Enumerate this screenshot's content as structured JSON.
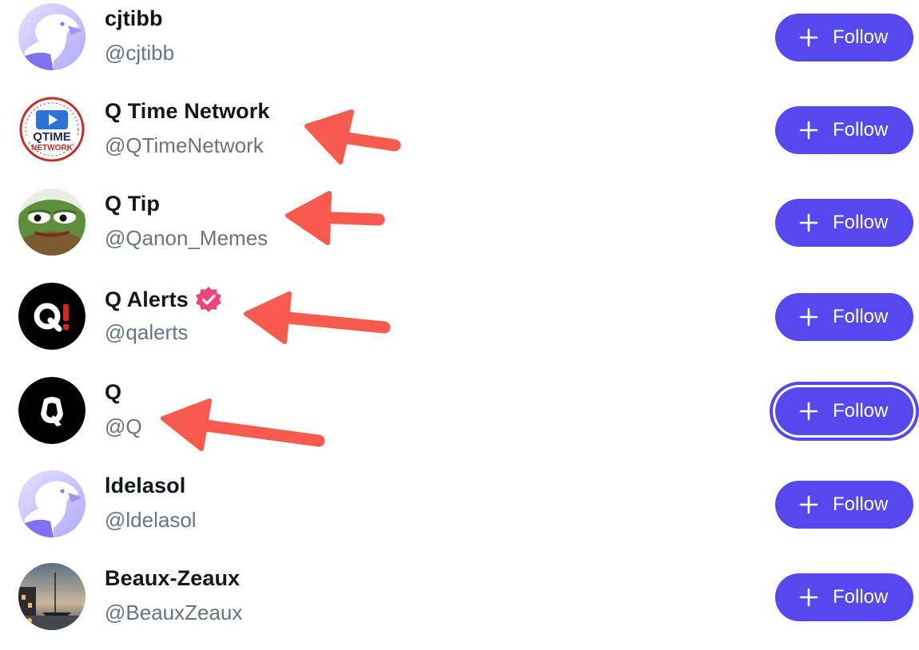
{
  "follow_label": "Follow",
  "colors": {
    "accent": "#5448ee",
    "annotation_arrow": "#f75b4e",
    "verified_badge": "#f0437c"
  },
  "users": [
    {
      "display_name": "cjtibb",
      "handle": "@cjtibb",
      "avatar": "eagle-icon",
      "verified": false,
      "arrow": false
    },
    {
      "display_name": "Q Time Network",
      "handle": "@QTimeNetwork",
      "avatar": "qtime-logo",
      "verified": false,
      "arrow": true
    },
    {
      "display_name": "Q Tip",
      "handle": "@Qanon_Memes",
      "avatar": "frog-avatar",
      "verified": false,
      "arrow": true
    },
    {
      "display_name": "Q Alerts",
      "handle": "@qalerts",
      "avatar": "q-alert-logo",
      "verified": true,
      "arrow": true
    },
    {
      "display_name": "Q",
      "handle": "@Q",
      "avatar": "q-logo",
      "verified": false,
      "arrow": true,
      "button_focused": true
    },
    {
      "display_name": "ldelasol",
      "handle": "@ldelasol",
      "avatar": "eagle-icon",
      "verified": false,
      "arrow": false
    },
    {
      "display_name": "Beaux-Zeaux",
      "handle": "@BeauxZeaux",
      "avatar": "harbor-photo",
      "verified": false,
      "arrow": false
    }
  ]
}
